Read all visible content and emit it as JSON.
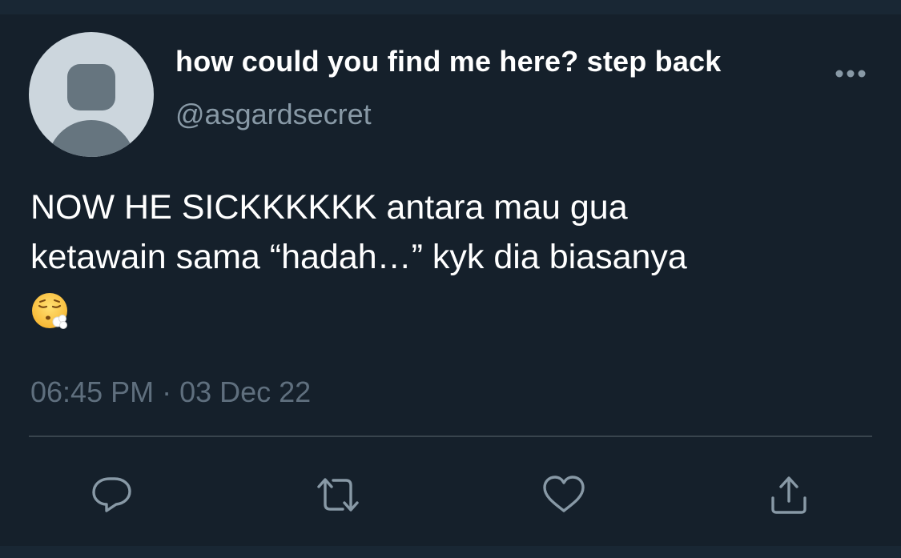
{
  "tweet": {
    "display_name": "how could you find me here? step back",
    "handle": "@asgardsecret",
    "text": "NOW HE SICKKKKKK antara mau gua\nketawain sama “hadah…” kyk dia biasanya",
    "emoji": "face-exhaling-emoji",
    "timestamp": "06:45 PM · 03 Dec 22"
  },
  "icons": {
    "more": "more-horizontal-icon",
    "reply": "reply-icon",
    "retweet": "retweet-icon",
    "like": "heart-icon",
    "share": "share-icon"
  },
  "colors": {
    "background": "#15202b",
    "text_primary": "#ffffff",
    "text_secondary": "#8899a6",
    "timestamp": "#5f6f7e",
    "divider": "#38444d",
    "icon": "#8899a6",
    "avatar_bg": "#ccd6dd",
    "avatar_fg": "#66757f"
  }
}
